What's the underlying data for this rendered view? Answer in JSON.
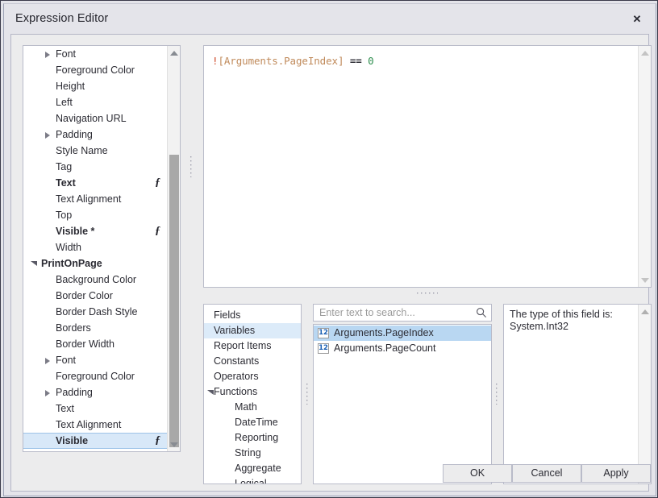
{
  "window": {
    "title": "Expression Editor",
    "close_label": "✕"
  },
  "property_tree": {
    "items": [
      {
        "label": "Font",
        "depth": 1,
        "caret": "collapsed",
        "bold": false,
        "fx": false,
        "selected": false
      },
      {
        "label": "Foreground Color",
        "depth": 1,
        "caret": "none",
        "bold": false,
        "fx": false,
        "selected": false
      },
      {
        "label": "Height",
        "depth": 1,
        "caret": "none",
        "bold": false,
        "fx": false,
        "selected": false
      },
      {
        "label": "Left",
        "depth": 1,
        "caret": "none",
        "bold": false,
        "fx": false,
        "selected": false
      },
      {
        "label": "Navigation URL",
        "depth": 1,
        "caret": "none",
        "bold": false,
        "fx": false,
        "selected": false
      },
      {
        "label": "Padding",
        "depth": 1,
        "caret": "collapsed",
        "bold": false,
        "fx": false,
        "selected": false
      },
      {
        "label": "Style Name",
        "depth": 1,
        "caret": "none",
        "bold": false,
        "fx": false,
        "selected": false
      },
      {
        "label": "Tag",
        "depth": 1,
        "caret": "none",
        "bold": false,
        "fx": false,
        "selected": false
      },
      {
        "label": "Text",
        "depth": 1,
        "caret": "none",
        "bold": true,
        "fx": true,
        "selected": false
      },
      {
        "label": "Text Alignment",
        "depth": 1,
        "caret": "none",
        "bold": false,
        "fx": false,
        "selected": false
      },
      {
        "label": "Top",
        "depth": 1,
        "caret": "none",
        "bold": false,
        "fx": false,
        "selected": false
      },
      {
        "label": "Visible *",
        "depth": 1,
        "caret": "none",
        "bold": true,
        "fx": true,
        "selected": false
      },
      {
        "label": "Width",
        "depth": 1,
        "caret": "none",
        "bold": false,
        "fx": false,
        "selected": false
      },
      {
        "label": "PrintOnPage",
        "depth": 0,
        "caret": "expanded",
        "bold": true,
        "fx": false,
        "selected": false
      },
      {
        "label": "Background Color",
        "depth": 1,
        "caret": "none",
        "bold": false,
        "fx": false,
        "selected": false
      },
      {
        "label": "Border Color",
        "depth": 1,
        "caret": "none",
        "bold": false,
        "fx": false,
        "selected": false
      },
      {
        "label": "Border Dash Style",
        "depth": 1,
        "caret": "none",
        "bold": false,
        "fx": false,
        "selected": false
      },
      {
        "label": "Borders",
        "depth": 1,
        "caret": "none",
        "bold": false,
        "fx": false,
        "selected": false
      },
      {
        "label": "Border Width",
        "depth": 1,
        "caret": "none",
        "bold": false,
        "fx": false,
        "selected": false
      },
      {
        "label": "Font",
        "depth": 1,
        "caret": "collapsed",
        "bold": false,
        "fx": false,
        "selected": false
      },
      {
        "label": "Foreground Color",
        "depth": 1,
        "caret": "none",
        "bold": false,
        "fx": false,
        "selected": false
      },
      {
        "label": "Padding",
        "depth": 1,
        "caret": "collapsed",
        "bold": false,
        "fx": false,
        "selected": false
      },
      {
        "label": "Text",
        "depth": 1,
        "caret": "none",
        "bold": false,
        "fx": false,
        "selected": false
      },
      {
        "label": "Text Alignment",
        "depth": 1,
        "caret": "none",
        "bold": false,
        "fx": false,
        "selected": false
      },
      {
        "label": "Visible",
        "depth": 1,
        "caret": "none",
        "bold": true,
        "fx": true,
        "selected": true
      }
    ],
    "fx_glyph": "ƒ"
  },
  "expression": {
    "tokens": [
      {
        "text": "!",
        "type": "op"
      },
      {
        "text": "[Arguments.PageIndex]",
        "type": "field"
      },
      {
        "text": " == ",
        "type": "eq"
      },
      {
        "text": "0",
        "type": "num"
      }
    ],
    "plain": "![Arguments.PageIndex] == 0"
  },
  "categories": {
    "items": [
      {
        "label": "Fields",
        "child": false,
        "caret": "none",
        "selected": false
      },
      {
        "label": "Variables",
        "child": false,
        "caret": "none",
        "selected": true
      },
      {
        "label": "Report Items",
        "child": false,
        "caret": "none",
        "selected": false
      },
      {
        "label": "Constants",
        "child": false,
        "caret": "none",
        "selected": false
      },
      {
        "label": "Operators",
        "child": false,
        "caret": "none",
        "selected": false
      },
      {
        "label": "Functions",
        "child": false,
        "caret": "expanded",
        "selected": false
      },
      {
        "label": "Math",
        "child": true,
        "caret": "none",
        "selected": false
      },
      {
        "label": "DateTime",
        "child": true,
        "caret": "none",
        "selected": false
      },
      {
        "label": "Reporting",
        "child": true,
        "caret": "none",
        "selected": false
      },
      {
        "label": "String",
        "child": true,
        "caret": "none",
        "selected": false
      },
      {
        "label": "Aggregate",
        "child": true,
        "caret": "none",
        "selected": false
      },
      {
        "label": "Logical",
        "child": true,
        "caret": "none",
        "selected": false
      }
    ]
  },
  "search": {
    "placeholder": "Enter text to search...",
    "value": ""
  },
  "item_list": {
    "items": [
      {
        "label": "Arguments.PageIndex",
        "icon_text": "12",
        "selected": true
      },
      {
        "label": "Arguments.PageCount",
        "icon_text": "12",
        "selected": false
      }
    ]
  },
  "description": {
    "text": "The type of this field is: System.Int32"
  },
  "buttons": {
    "ok": "OK",
    "cancel": "Cancel",
    "apply": "Apply"
  },
  "colors": {
    "selection_blue": "#b9d7f2",
    "tree_selection": "#d8e8f8",
    "dialog_bg": "#ececed",
    "chrome_bg": "#e4e4ea",
    "operator": "#d04a2a",
    "field": "#c08a5a",
    "number": "#2f8f4f"
  }
}
